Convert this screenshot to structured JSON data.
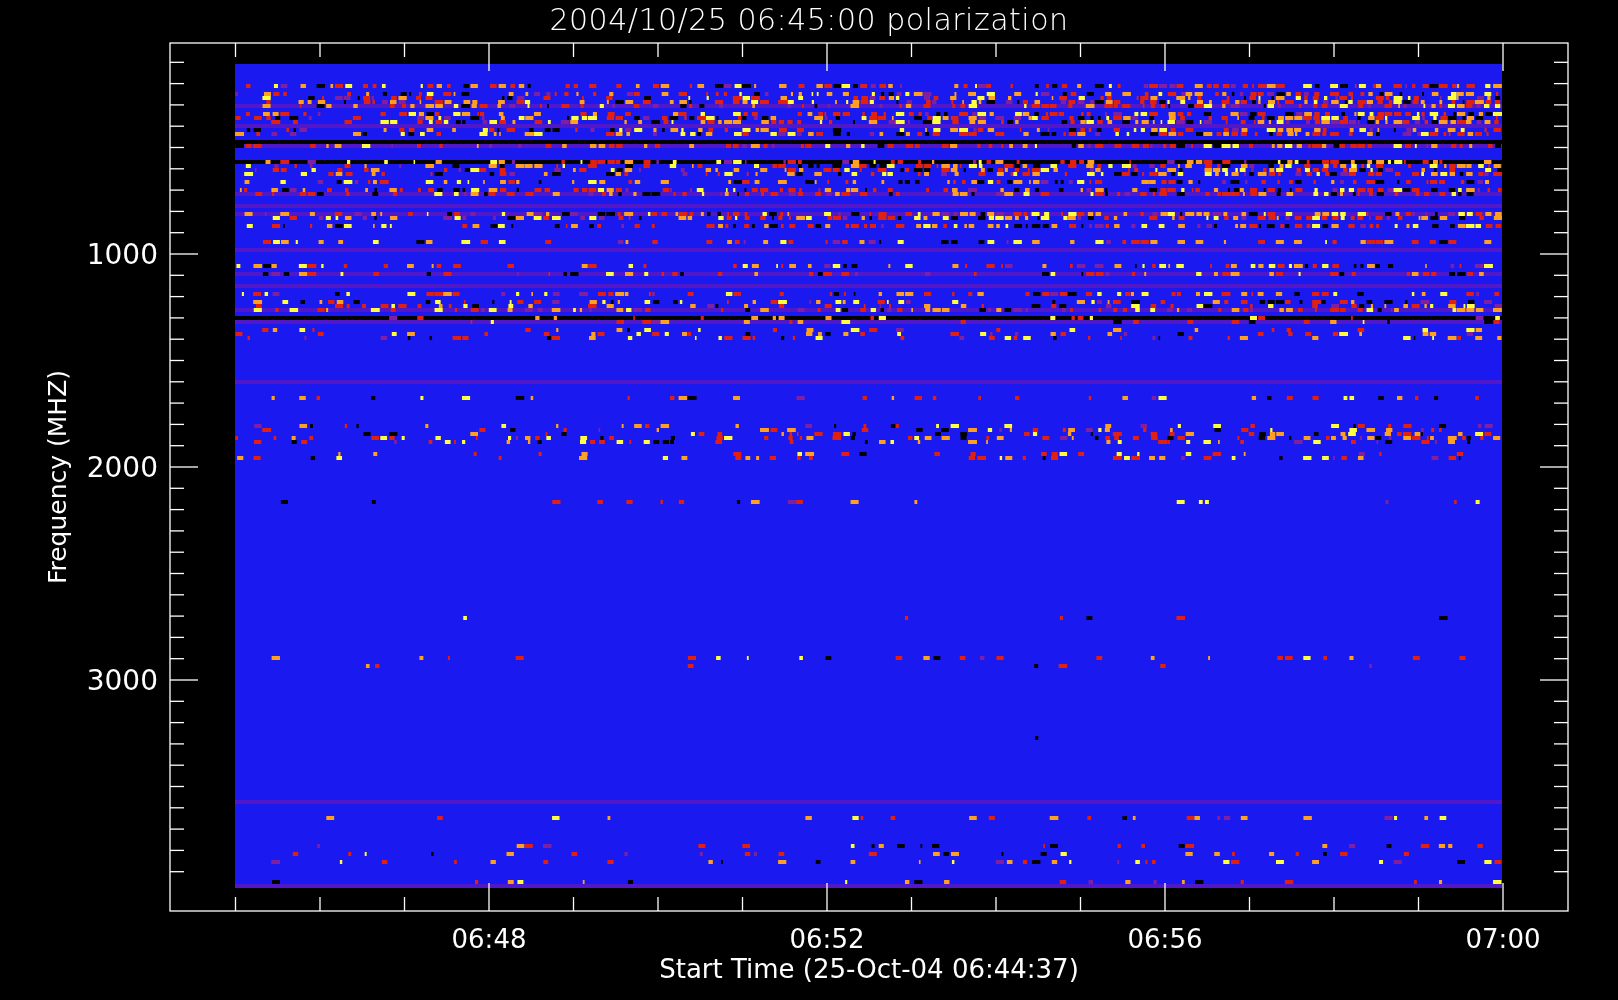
{
  "title": "2004/10/25 06:45:00 polarization",
  "y_axis": {
    "label": "Frequency (MHZ)",
    "ticks": [
      "1000",
      "2000",
      "3000"
    ]
  },
  "x_axis": {
    "label": "Start Time (25-Oct-04 06:44:37)",
    "ticks": [
      "06:48",
      "06:52",
      "06:56",
      "07:00"
    ]
  }
}
